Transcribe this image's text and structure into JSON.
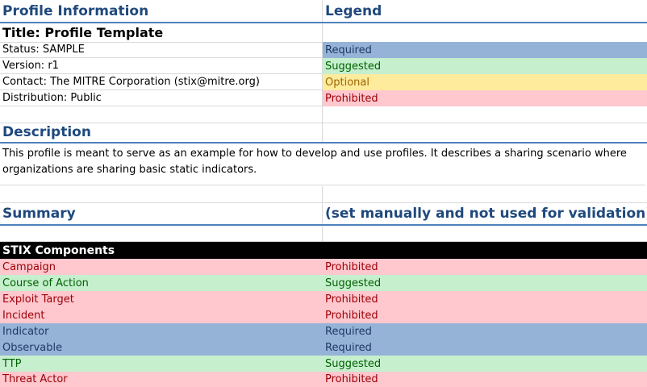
{
  "headers": {
    "profile_info": "Profile Information",
    "legend": "Legend",
    "description": "Description",
    "summary": "Summary",
    "summary_note": "(set manually and not used for validation)"
  },
  "title": "Title: Profile Template",
  "info": {
    "status": "Status: SAMPLE",
    "version": "Version: r1",
    "contact": "Contact: The MITRE Corporation (stix@mitre.org)",
    "distribution": "Distribution: Public"
  },
  "legend": {
    "required": "Required",
    "suggested": "Suggested",
    "optional": "Optional",
    "prohibited": "Prohibited"
  },
  "description_text": "This profile is meant to serve as an example for how to develop and use profiles. It describes a sharing scenario where organizations are sharing basic static indicators.",
  "components_header": "STIX Components",
  "components": [
    {
      "name": "Campaign",
      "status": "Prohibited"
    },
    {
      "name": "Course of Action",
      "status": "Suggested"
    },
    {
      "name": "Exploit Target",
      "status": "Prohibited"
    },
    {
      "name": "Incident",
      "status": "Prohibited"
    },
    {
      "name": "Indicator",
      "status": "Required"
    },
    {
      "name": "Observable",
      "status": "Required"
    },
    {
      "name": "TTP",
      "status": "Suggested"
    },
    {
      "name": "Threat Actor",
      "status": "Prohibited"
    }
  ],
  "colors": {
    "header_text": "#1f497d",
    "required_bg": "#95b3d7",
    "suggested_bg": "#c6efce",
    "optional_bg": "#ffeb9c",
    "prohibited_bg": "#ffc7ce"
  }
}
